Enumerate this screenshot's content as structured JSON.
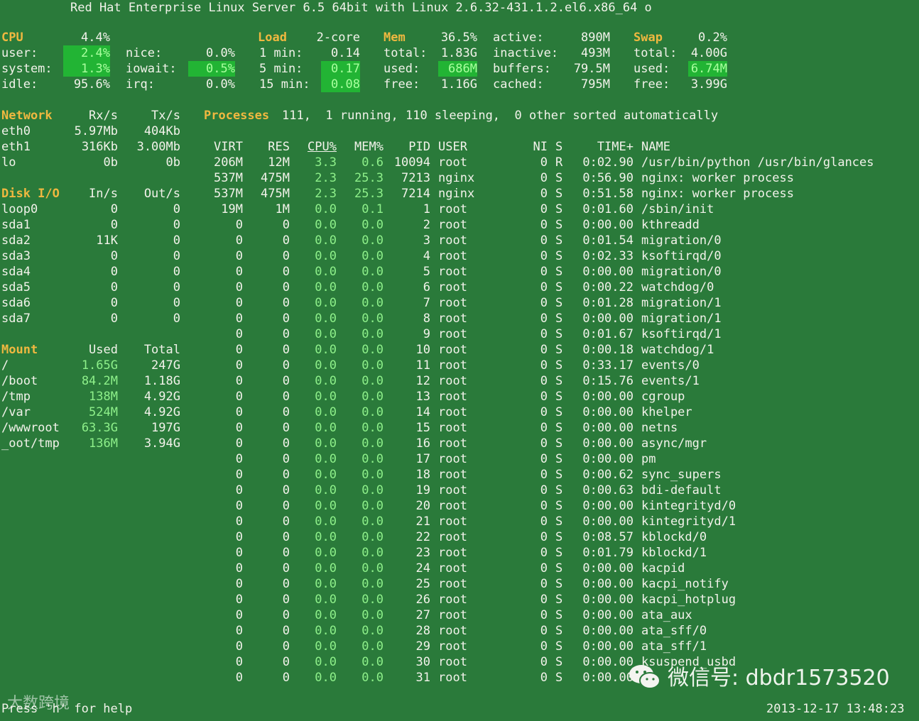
{
  "colors": {
    "background": "#2a7a3a",
    "text": "#f2f2ea",
    "header": "#f0b840",
    "ok_green": "#8ef08a",
    "highlight_bg": "#22b434"
  },
  "title": "Red Hat Enterprise Linux Server 6.5 64bit with Linux 2.6.32-431.1.2.el6.x86_64 o",
  "cpu": {
    "header": "CPU",
    "total": "4.4%",
    "rows": [
      {
        "l1": "user:",
        "v1": "2.4%",
        "l2": "nice:",
        "v2": "0.0%"
      },
      {
        "l1": "system:",
        "v1": "1.3%",
        "l2": "iowait:",
        "v2": "0.5%"
      },
      {
        "l1": "idle:",
        "v1": "95.6%",
        "l2": "irq:",
        "v2": "0.0%"
      }
    ]
  },
  "load": {
    "header": "Load",
    "cores": "2-core",
    "rows": [
      {
        "l": "1 min:",
        "v": "0.14"
      },
      {
        "l": "5 min:",
        "v": "0.17"
      },
      {
        "l": "15 min:",
        "v": "0.08"
      }
    ]
  },
  "mem": {
    "header": "Mem",
    "pct": "36.5%",
    "rows": [
      {
        "l": "total:",
        "v": "1.83G"
      },
      {
        "l": "used:",
        "v": "686M"
      },
      {
        "l": "free:",
        "v": "1.16G"
      }
    ],
    "rows2": [
      {
        "l": "active:",
        "v": "890M"
      },
      {
        "l": "inactive:",
        "v": "493M"
      },
      {
        "l": "buffers:",
        "v": "79.5M"
      },
      {
        "l": "cached:",
        "v": "795M"
      }
    ]
  },
  "swap": {
    "header": "Swap",
    "pct": "0.2%",
    "rows": [
      {
        "l": "total:",
        "v": "4.00G"
      },
      {
        "l": "used:",
        "v": "6.74M"
      },
      {
        "l": "free:",
        "v": "3.99G"
      }
    ]
  },
  "network": {
    "header": "Network",
    "col_rx": "Rx/s",
    "col_tx": "Tx/s",
    "rows": [
      {
        "name": "eth0",
        "rx": "5.97Mb",
        "tx": "404Kb"
      },
      {
        "name": "eth1",
        "rx": "316Kb",
        "tx": "3.00Mb"
      },
      {
        "name": "lo",
        "rx": "0b",
        "tx": "0b"
      }
    ]
  },
  "disk": {
    "header": "Disk I/O",
    "col_in": "In/s",
    "col_out": "Out/s",
    "rows": [
      {
        "name": "loop0",
        "in": "0",
        "out": "0"
      },
      {
        "name": "sda1",
        "in": "0",
        "out": "0"
      },
      {
        "name": "sda2",
        "in": "11K",
        "out": "0"
      },
      {
        "name": "sda3",
        "in": "0",
        "out": "0"
      },
      {
        "name": "sda4",
        "in": "0",
        "out": "0"
      },
      {
        "name": "sda5",
        "in": "0",
        "out": "0"
      },
      {
        "name": "sda6",
        "in": "0",
        "out": "0"
      },
      {
        "name": "sda7",
        "in": "0",
        "out": "0"
      }
    ]
  },
  "mount": {
    "header": "Mount",
    "col_used": "Used",
    "col_total": "Total",
    "rows": [
      {
        "name": "/",
        "used": "1.65G",
        "total": "247G"
      },
      {
        "name": "/boot",
        "used": "84.2M",
        "total": "1.18G"
      },
      {
        "name": "/tmp",
        "used": "138M",
        "total": "4.92G"
      },
      {
        "name": "/var",
        "used": "524M",
        "total": "4.92G"
      },
      {
        "name": "/wwwroot",
        "used": "63.3G",
        "total": "197G"
      },
      {
        "name": "_oot/tmp",
        "used": "136M",
        "total": "3.94G"
      }
    ]
  },
  "processes": {
    "summary_label": "Processes",
    "summary": "111,  1 running, 110 sleeping,  0 other sorted automatically",
    "columns": {
      "virt": "VIRT",
      "res": "RES",
      "cpu": "CPU%",
      "mem": "MEM%",
      "pid": "PID",
      "user": "USER",
      "ni": "NI",
      "s": "S",
      "time": "TIME+",
      "name": "NAME"
    },
    "rows": [
      {
        "virt": "206M",
        "res": "12M",
        "cpu": "3.3",
        "mem": "0.6",
        "pid": "10094",
        "user": "root",
        "ni": "0",
        "s": "R",
        "time": "0:02.90",
        "name": "/usr/bin/python /usr/bin/glances"
      },
      {
        "virt": "537M",
        "res": "475M",
        "cpu": "2.3",
        "mem": "25.3",
        "pid": "7213",
        "user": "nginx",
        "ni": "0",
        "s": "S",
        "time": "0:56.90",
        "name": "nginx: worker process"
      },
      {
        "virt": "537M",
        "res": "475M",
        "cpu": "2.3",
        "mem": "25.3",
        "pid": "7214",
        "user": "nginx",
        "ni": "0",
        "s": "S",
        "time": "0:51.58",
        "name": "nginx: worker process"
      },
      {
        "virt": "19M",
        "res": "1M",
        "cpu": "0.0",
        "mem": "0.1",
        "pid": "1",
        "user": "root",
        "ni": "0",
        "s": "S",
        "time": "0:01.60",
        "name": "/sbin/init"
      },
      {
        "virt": "0",
        "res": "0",
        "cpu": "0.0",
        "mem": "0.0",
        "pid": "2",
        "user": "root",
        "ni": "0",
        "s": "S",
        "time": "0:00.00",
        "name": "kthreadd"
      },
      {
        "virt": "0",
        "res": "0",
        "cpu": "0.0",
        "mem": "0.0",
        "pid": "3",
        "user": "root",
        "ni": "0",
        "s": "S",
        "time": "0:01.54",
        "name": "migration/0"
      },
      {
        "virt": "0",
        "res": "0",
        "cpu": "0.0",
        "mem": "0.0",
        "pid": "4",
        "user": "root",
        "ni": "0",
        "s": "S",
        "time": "0:02.33",
        "name": "ksoftirqd/0"
      },
      {
        "virt": "0",
        "res": "0",
        "cpu": "0.0",
        "mem": "0.0",
        "pid": "5",
        "user": "root",
        "ni": "0",
        "s": "S",
        "time": "0:00.00",
        "name": "migration/0"
      },
      {
        "virt": "0",
        "res": "0",
        "cpu": "0.0",
        "mem": "0.0",
        "pid": "6",
        "user": "root",
        "ni": "0",
        "s": "S",
        "time": "0:00.22",
        "name": "watchdog/0"
      },
      {
        "virt": "0",
        "res": "0",
        "cpu": "0.0",
        "mem": "0.0",
        "pid": "7",
        "user": "root",
        "ni": "0",
        "s": "S",
        "time": "0:01.28",
        "name": "migration/1"
      },
      {
        "virt": "0",
        "res": "0",
        "cpu": "0.0",
        "mem": "0.0",
        "pid": "8",
        "user": "root",
        "ni": "0",
        "s": "S",
        "time": "0:00.00",
        "name": "migration/1"
      },
      {
        "virt": "0",
        "res": "0",
        "cpu": "0.0",
        "mem": "0.0",
        "pid": "9",
        "user": "root",
        "ni": "0",
        "s": "S",
        "time": "0:01.67",
        "name": "ksoftirqd/1"
      },
      {
        "virt": "0",
        "res": "0",
        "cpu": "0.0",
        "mem": "0.0",
        "pid": "10",
        "user": "root",
        "ni": "0",
        "s": "S",
        "time": "0:00.18",
        "name": "watchdog/1"
      },
      {
        "virt": "0",
        "res": "0",
        "cpu": "0.0",
        "mem": "0.0",
        "pid": "11",
        "user": "root",
        "ni": "0",
        "s": "S",
        "time": "0:33.17",
        "name": "events/0"
      },
      {
        "virt": "0",
        "res": "0",
        "cpu": "0.0",
        "mem": "0.0",
        "pid": "12",
        "user": "root",
        "ni": "0",
        "s": "S",
        "time": "0:15.76",
        "name": "events/1"
      },
      {
        "virt": "0",
        "res": "0",
        "cpu": "0.0",
        "mem": "0.0",
        "pid": "13",
        "user": "root",
        "ni": "0",
        "s": "S",
        "time": "0:00.00",
        "name": "cgroup"
      },
      {
        "virt": "0",
        "res": "0",
        "cpu": "0.0",
        "mem": "0.0",
        "pid": "14",
        "user": "root",
        "ni": "0",
        "s": "S",
        "time": "0:00.00",
        "name": "khelper"
      },
      {
        "virt": "0",
        "res": "0",
        "cpu": "0.0",
        "mem": "0.0",
        "pid": "15",
        "user": "root",
        "ni": "0",
        "s": "S",
        "time": "0:00.00",
        "name": "netns"
      },
      {
        "virt": "0",
        "res": "0",
        "cpu": "0.0",
        "mem": "0.0",
        "pid": "16",
        "user": "root",
        "ni": "0",
        "s": "S",
        "time": "0:00.00",
        "name": "async/mgr"
      },
      {
        "virt": "0",
        "res": "0",
        "cpu": "0.0",
        "mem": "0.0",
        "pid": "17",
        "user": "root",
        "ni": "0",
        "s": "S",
        "time": "0:00.00",
        "name": "pm"
      },
      {
        "virt": "0",
        "res": "0",
        "cpu": "0.0",
        "mem": "0.0",
        "pid": "18",
        "user": "root",
        "ni": "0",
        "s": "S",
        "time": "0:00.62",
        "name": "sync_supers"
      },
      {
        "virt": "0",
        "res": "0",
        "cpu": "0.0",
        "mem": "0.0",
        "pid": "19",
        "user": "root",
        "ni": "0",
        "s": "S",
        "time": "0:00.63",
        "name": "bdi-default"
      },
      {
        "virt": "0",
        "res": "0",
        "cpu": "0.0",
        "mem": "0.0",
        "pid": "20",
        "user": "root",
        "ni": "0",
        "s": "S",
        "time": "0:00.00",
        "name": "kintegrityd/0"
      },
      {
        "virt": "0",
        "res": "0",
        "cpu": "0.0",
        "mem": "0.0",
        "pid": "21",
        "user": "root",
        "ni": "0",
        "s": "S",
        "time": "0:00.00",
        "name": "kintegrityd/1"
      },
      {
        "virt": "0",
        "res": "0",
        "cpu": "0.0",
        "mem": "0.0",
        "pid": "22",
        "user": "root",
        "ni": "0",
        "s": "S",
        "time": "0:08.57",
        "name": "kblockd/0"
      },
      {
        "virt": "0",
        "res": "0",
        "cpu": "0.0",
        "mem": "0.0",
        "pid": "23",
        "user": "root",
        "ni": "0",
        "s": "S",
        "time": "0:01.79",
        "name": "kblockd/1"
      },
      {
        "virt": "0",
        "res": "0",
        "cpu": "0.0",
        "mem": "0.0",
        "pid": "24",
        "user": "root",
        "ni": "0",
        "s": "S",
        "time": "0:00.00",
        "name": "kacpid"
      },
      {
        "virt": "0",
        "res": "0",
        "cpu": "0.0",
        "mem": "0.0",
        "pid": "25",
        "user": "root",
        "ni": "0",
        "s": "S",
        "time": "0:00.00",
        "name": "kacpi_notify"
      },
      {
        "virt": "0",
        "res": "0",
        "cpu": "0.0",
        "mem": "0.0",
        "pid": "26",
        "user": "root",
        "ni": "0",
        "s": "S",
        "time": "0:00.00",
        "name": "kacpi_hotplug"
      },
      {
        "virt": "0",
        "res": "0",
        "cpu": "0.0",
        "mem": "0.0",
        "pid": "27",
        "user": "root",
        "ni": "0",
        "s": "S",
        "time": "0:00.00",
        "name": "ata_aux"
      },
      {
        "virt": "0",
        "res": "0",
        "cpu": "0.0",
        "mem": "0.0",
        "pid": "28",
        "user": "root",
        "ni": "0",
        "s": "S",
        "time": "0:00.00",
        "name": "ata_sff/0"
      },
      {
        "virt": "0",
        "res": "0",
        "cpu": "0.0",
        "mem": "0.0",
        "pid": "29",
        "user": "root",
        "ni": "0",
        "s": "S",
        "time": "0:00.00",
        "name": "ata_sff/1"
      },
      {
        "virt": "0",
        "res": "0",
        "cpu": "0.0",
        "mem": "0.0",
        "pid": "30",
        "user": "root",
        "ni": "0",
        "s": "S",
        "time": "0:00.00",
        "name": "ksuspend_usbd"
      },
      {
        "virt": "0",
        "res": "0",
        "cpu": "0.0",
        "mem": "0.0",
        "pid": "31",
        "user": "root",
        "ni": "0",
        "s": "S",
        "time": "0:00.00",
        "name": ""
      }
    ]
  },
  "footer": {
    "help": "Press 'h' for help",
    "timestamp": "2013-12-17 13:48:23"
  },
  "watermark": {
    "wechat_id": "微信号: dbdr1573520",
    "brand": "大数跨境"
  }
}
